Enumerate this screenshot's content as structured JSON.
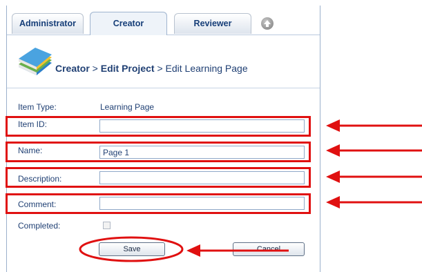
{
  "tabs": [
    {
      "label": "Administrator"
    },
    {
      "label": "Creator"
    },
    {
      "label": "Reviewer"
    }
  ],
  "breadcrumb": {
    "root": "Creator",
    "sep1": " > ",
    "middle": "Edit Project",
    "sep2": " > ",
    "current": "Edit Learning Page"
  },
  "form": {
    "item_type_label": "Item Type:",
    "item_type_value": "Learning Page",
    "item_id_label": "Item ID:",
    "item_id_value": "",
    "name_label": "Name:",
    "name_value": "Page 1",
    "description_label": "Description:",
    "description_value": "",
    "comment_label": "Comment:",
    "comment_value": "",
    "completed_label": "Completed:"
  },
  "buttons": {
    "save": "Save",
    "cancel": "Cancel"
  },
  "colors": {
    "annotation": "#e01010",
    "text": "#1f3f73"
  }
}
